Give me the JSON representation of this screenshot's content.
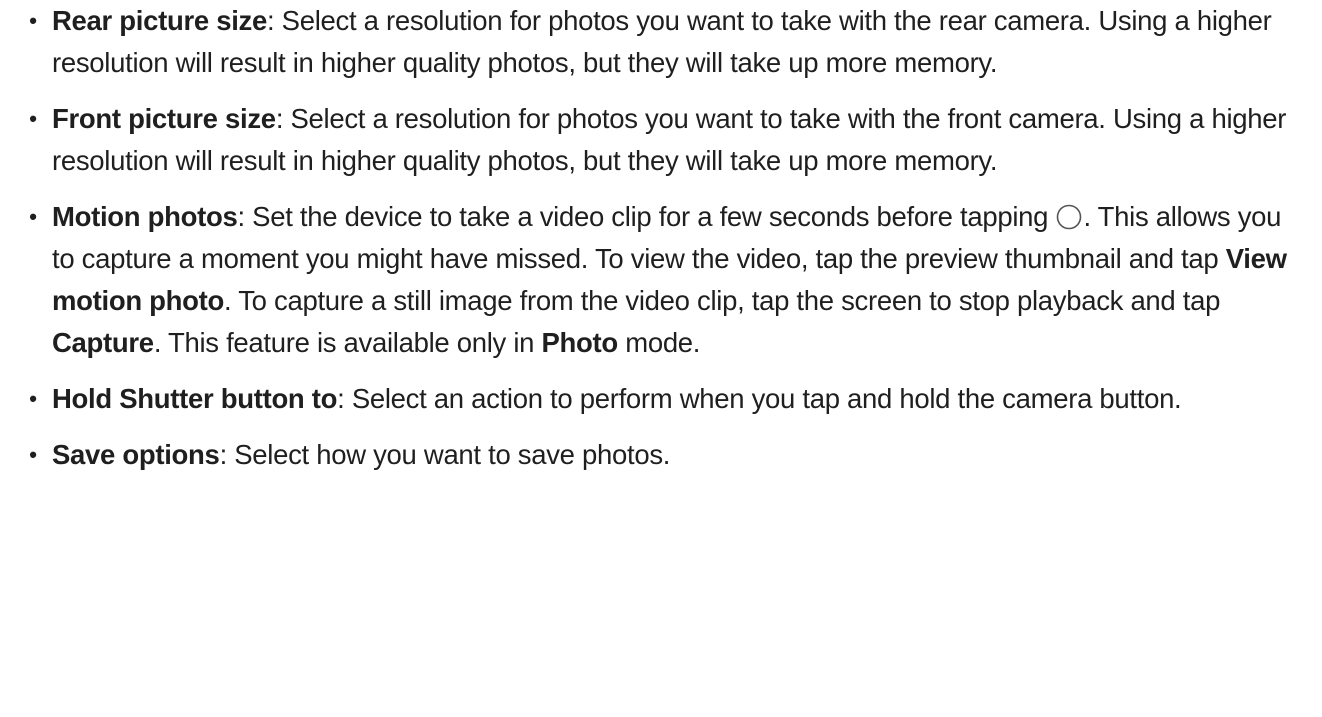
{
  "items": [
    {
      "term": "Rear picture size",
      "text": ": Select a resolution for photos you want to take with the rear camera. Using a higher resolution will result in higher quality photos, but they will take up more memory."
    },
    {
      "term": "Front picture size",
      "text": ": Select a resolution for photos you want to take with the front camera. Using a higher resolution will result in higher quality photos, but they will take up more memory."
    },
    {
      "term": "Motion photos",
      "text_before_icon": ": Set the device to take a video clip for a few seconds before tapping ",
      "icon": "shutter-button-icon",
      "text_after_icon": ". This allows you to capture a moment you might have missed. To view the video, tap the preview thumbnail and tap ",
      "ui_term_1": "View motion photo",
      "text_2": ". To capture a still image from the video clip, tap the screen to stop playback and tap ",
      "ui_term_2": "Capture",
      "text_3": ". This feature is available only in ",
      "ui_term_3": "Photo",
      "text_4": " mode."
    },
    {
      "term": "Hold Shutter button to",
      "text": ": Select an action to perform when you tap and hold the camera button."
    },
    {
      "term": "Save options",
      "text": ": Select how you want to save photos."
    }
  ],
  "bullet_char": "•"
}
